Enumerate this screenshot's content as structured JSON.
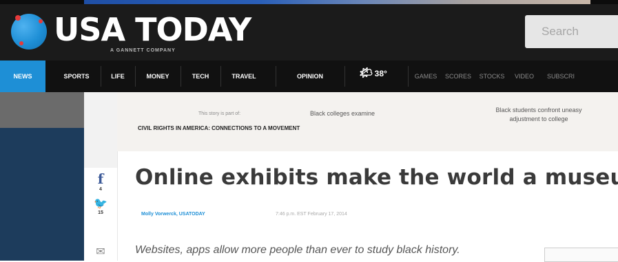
{
  "header": {
    "logo_text": "USA TODAY",
    "logo_subtitle": "A GANNETT COMPANY",
    "search_placeholder": "Search"
  },
  "nav": {
    "items": [
      {
        "label": "NEWS",
        "active": true
      },
      {
        "label": "SPORTS"
      },
      {
        "label": "LIFE"
      },
      {
        "label": "MONEY"
      },
      {
        "label": "TECH"
      },
      {
        "label": "TRAVEL"
      },
      {
        "label": "OPINION"
      }
    ],
    "weather": "38°",
    "secondary": [
      "GAMES",
      "SCORES",
      "STOCKS",
      "VIDEO",
      "SUBSCRI"
    ]
  },
  "share": {
    "facebook_count": "4",
    "twitter_count": "15"
  },
  "topic": {
    "series_intro": "This story is part of:",
    "series_title": "CIVIL RIGHTS IN AMERICA: CONNECTIONS TO A MOVEMENT",
    "related_1": "Black colleges examine",
    "related_2": "Black students confront uneasy adjustment to college"
  },
  "article": {
    "headline": "Online exhibits make the world a museum",
    "byline": "Molly Vorwerck, USATODAY",
    "dateline": "7:46 p.m. EST February 17, 2014",
    "dek": "Websites, apps allow more people than ever to study black history."
  },
  "colors": {
    "brand_blue": "#1e8fd6",
    "masthead": "#1b1b1b",
    "nav": "#111111"
  }
}
